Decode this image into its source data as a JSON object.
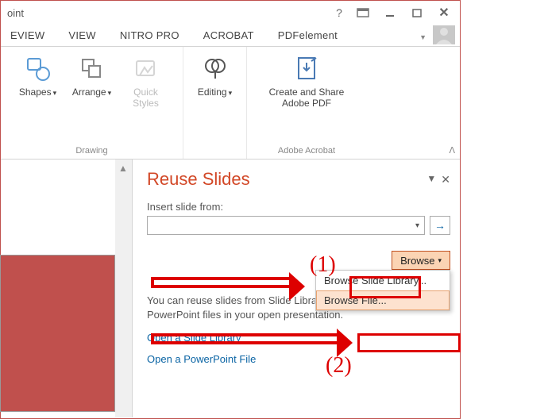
{
  "window": {
    "title_fragment": "oint"
  },
  "ribbon": {
    "tabs": [
      "EVIEW",
      "VIEW",
      "NITRO PRO",
      "ACROBAT",
      "PDFelement"
    ],
    "groups": {
      "drawing": {
        "label": "Drawing",
        "shapes": "Shapes",
        "arrange": "Arrange",
        "quick_styles": "Quick\nStyles"
      },
      "editing": {
        "label": "Editing"
      },
      "acrobat": {
        "label": "Adobe Acrobat",
        "button": "Create and Share\nAdobe PDF"
      }
    }
  },
  "pane": {
    "title": "Reuse Slides",
    "insert_label": "Insert slide from:",
    "browse": "Browse",
    "menu": {
      "library": "Browse Slide Library...",
      "file": "Browse File..."
    },
    "info": "You can reuse slides from Slide Libraries or other PowerPoint files in your open presentation.",
    "link_library": "Open a Slide Library",
    "link_file": "Open a PowerPoint File"
  },
  "annotations": {
    "num1": "(1)",
    "num2": "(2)"
  }
}
